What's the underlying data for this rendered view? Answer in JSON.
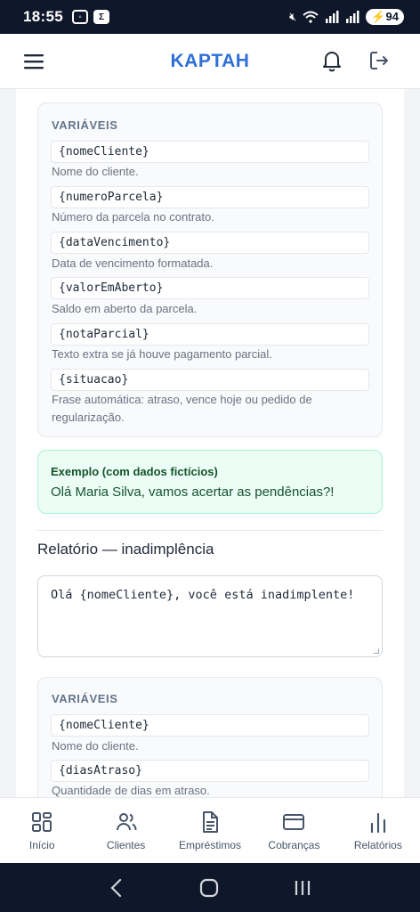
{
  "status_bar": {
    "time": "18:55",
    "battery": "94",
    "notif_icon": "sigma"
  },
  "header": {
    "title": "KAPTAH"
  },
  "variables_block_1": {
    "title": "VARIÁVEIS",
    "items": [
      {
        "code": "{nomeCliente}",
        "desc": "Nome do cliente."
      },
      {
        "code": "{numeroParcela}",
        "desc": "Número da parcela no contrato."
      },
      {
        "code": "{dataVencimento}",
        "desc": "Data de vencimento formatada."
      },
      {
        "code": "{valorEmAberto}",
        "desc": "Saldo em aberto da parcela."
      },
      {
        "code": "{notaParcial}",
        "desc": "Texto extra se já houve pagamento parcial."
      },
      {
        "code": "{situacao}",
        "desc_line1": "Frase automática: atraso, vence hoje ou pedido de",
        "desc_line2": "regularização."
      }
    ]
  },
  "example": {
    "title": "Exemplo (com dados fictícios)",
    "text": "Olá Maria Silva, vamos acertar as pendências?!"
  },
  "report_section": {
    "title": "Relatório — inadimplência",
    "template_value": "Olá {nomeCliente}, você está inadimplente!"
  },
  "variables_block_2": {
    "title": "VARIÁVEIS",
    "items": [
      {
        "code": "{nomeCliente}",
        "desc": "Nome do cliente."
      },
      {
        "code": "{diasAtraso}",
        "desc": "Quantidade de dias em atraso."
      }
    ]
  },
  "bottom_nav": {
    "items": [
      {
        "label": "Início",
        "icon": "grid-icon"
      },
      {
        "label": "Clientes",
        "icon": "users-icon"
      },
      {
        "label": "Empréstimos",
        "icon": "document-icon"
      },
      {
        "label": "Cobranças",
        "icon": "card-icon"
      },
      {
        "label": "Relatórios",
        "icon": "bar-chart-icon"
      }
    ]
  },
  "colors": {
    "brand": "#2f6fd6",
    "example_bg": "#ecfdf5",
    "example_text": "#14532d"
  }
}
